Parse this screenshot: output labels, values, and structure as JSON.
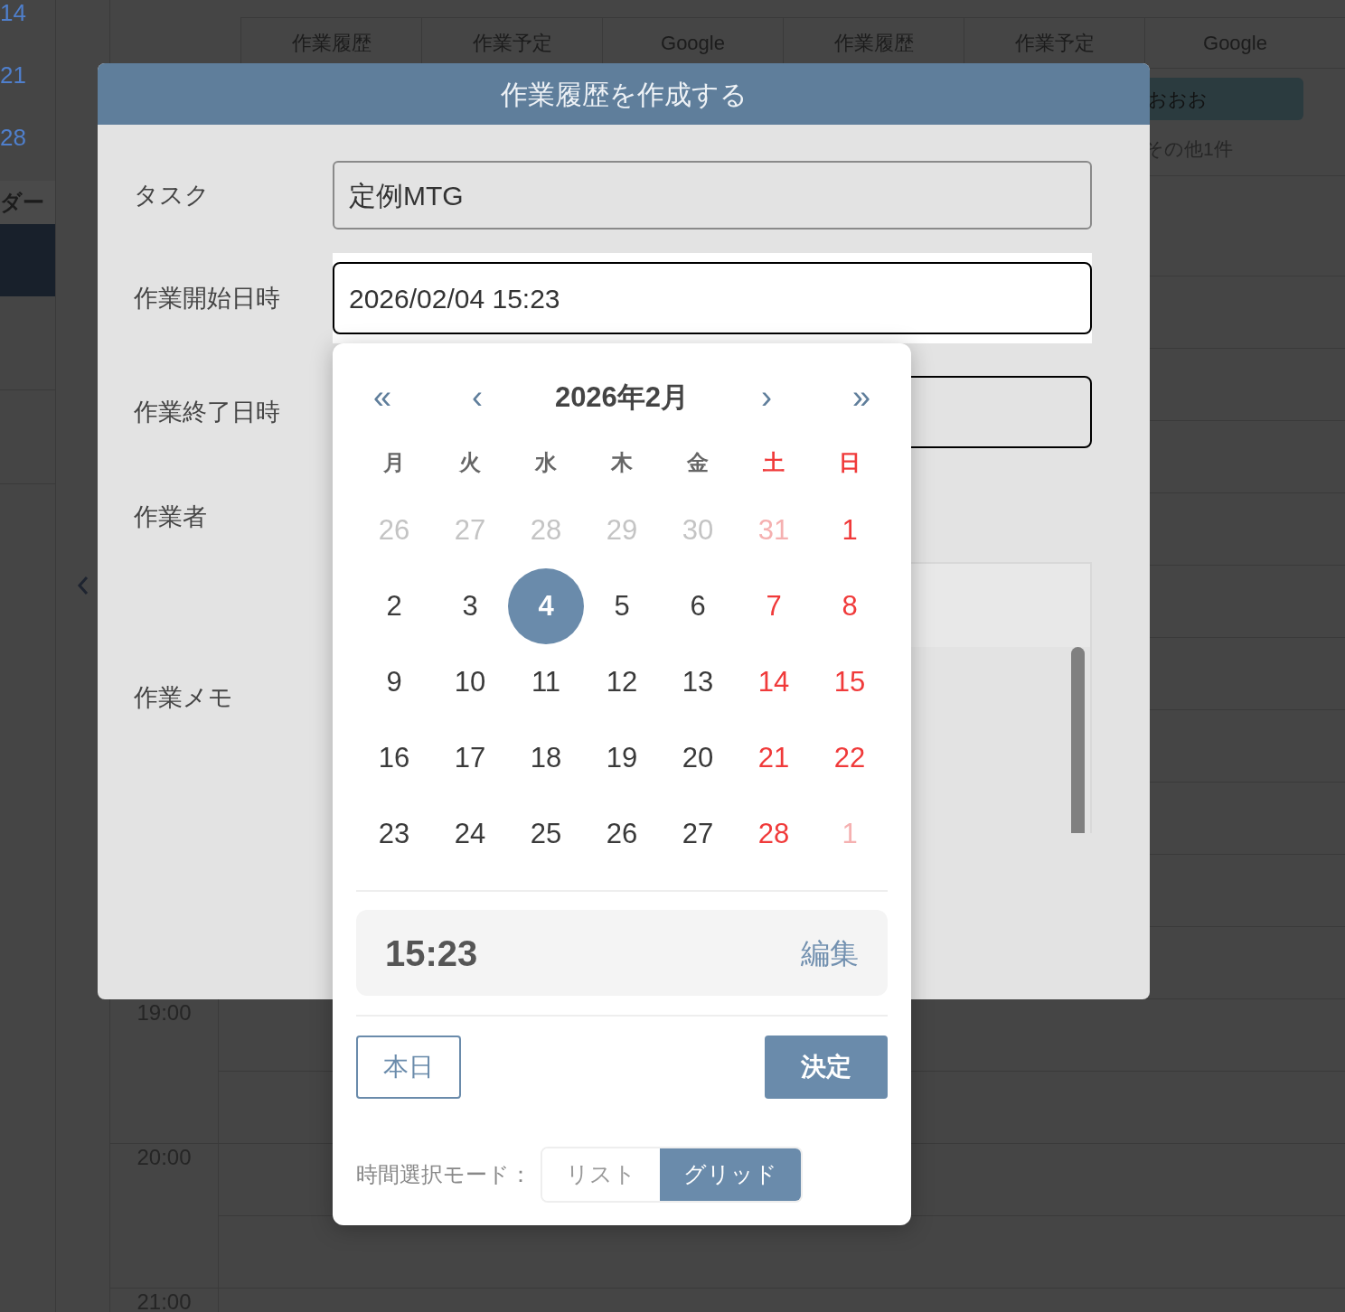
{
  "background": {
    "sidebar_dates": [
      "14",
      "21",
      "28"
    ],
    "sidebar_label": "ダー",
    "column_headers": [
      "作業履歴",
      "作業予定",
      "Google",
      "作業履歴",
      "作業予定",
      "Google"
    ],
    "event": {
      "title": "おおお",
      "more": "その他1件"
    },
    "times": [
      "19:00",
      "20:00",
      "21:00"
    ]
  },
  "dialog": {
    "title": "作業履歴を作成する",
    "fields": [
      {
        "label": "タスク",
        "kind": "text",
        "value": "定例MTG"
      },
      {
        "label": "作業開始日時",
        "kind": "datetime",
        "value": "2026/02/04 15:23",
        "focused": true
      },
      {
        "label": "作業終了日時",
        "kind": "datetime",
        "focused": false
      },
      {
        "label": "作業者",
        "kind": "hidden"
      },
      {
        "label": "作業メモ",
        "kind": "memo"
      }
    ]
  },
  "picker": {
    "nav": [
      "«",
      "‹",
      "›",
      "»"
    ],
    "month": "2026年2月",
    "weekdays": [
      {
        "label": "月",
        "weekend": false
      },
      {
        "label": "火",
        "weekend": false
      },
      {
        "label": "水",
        "weekend": false
      },
      {
        "label": "木",
        "weekend": false
      },
      {
        "label": "金",
        "weekend": false
      },
      {
        "label": "土",
        "weekend": true
      },
      {
        "label": "日",
        "weekend": true
      }
    ],
    "days": [
      {
        "label": "26",
        "outside": true,
        "weekend": false,
        "selected": false
      },
      {
        "label": "27",
        "outside": true,
        "weekend": false,
        "selected": false
      },
      {
        "label": "28",
        "outside": true,
        "weekend": false,
        "selected": false
      },
      {
        "label": "29",
        "outside": true,
        "weekend": false,
        "selected": false
      },
      {
        "label": "30",
        "outside": true,
        "weekend": false,
        "selected": false
      },
      {
        "label": "31",
        "outside": true,
        "weekend": true,
        "selected": false
      },
      {
        "label": "1",
        "outside": false,
        "weekend": true,
        "selected": false
      },
      {
        "label": "2",
        "outside": false,
        "weekend": false,
        "selected": false
      },
      {
        "label": "3",
        "outside": false,
        "weekend": false,
        "selected": false
      },
      {
        "label": "4",
        "outside": false,
        "weekend": false,
        "selected": true
      },
      {
        "label": "5",
        "outside": false,
        "weekend": false,
        "selected": false
      },
      {
        "label": "6",
        "outside": false,
        "weekend": false,
        "selected": false
      },
      {
        "label": "7",
        "outside": false,
        "weekend": true,
        "selected": false
      },
      {
        "label": "8",
        "outside": false,
        "weekend": true,
        "selected": false
      },
      {
        "label": "9",
        "outside": false,
        "weekend": false,
        "selected": false
      },
      {
        "label": "10",
        "outside": false,
        "weekend": false,
        "selected": false
      },
      {
        "label": "11",
        "outside": false,
        "weekend": false,
        "selected": false
      },
      {
        "label": "12",
        "outside": false,
        "weekend": false,
        "selected": false
      },
      {
        "label": "13",
        "outside": false,
        "weekend": false,
        "selected": false
      },
      {
        "label": "14",
        "outside": false,
        "weekend": true,
        "selected": false
      },
      {
        "label": "15",
        "outside": false,
        "weekend": true,
        "selected": false
      },
      {
        "label": "16",
        "outside": false,
        "weekend": false,
        "selected": false
      },
      {
        "label": "17",
        "outside": false,
        "weekend": false,
        "selected": false
      },
      {
        "label": "18",
        "outside": false,
        "weekend": false,
        "selected": false
      },
      {
        "label": "19",
        "outside": false,
        "weekend": false,
        "selected": false
      },
      {
        "label": "20",
        "outside": false,
        "weekend": false,
        "selected": false
      },
      {
        "label": "21",
        "outside": false,
        "weekend": true,
        "selected": false
      },
      {
        "label": "22",
        "outside": false,
        "weekend": true,
        "selected": false
      },
      {
        "label": "23",
        "outside": false,
        "weekend": false,
        "selected": false
      },
      {
        "label": "24",
        "outside": false,
        "weekend": false,
        "selected": false
      },
      {
        "label": "25",
        "outside": false,
        "weekend": false,
        "selected": false
      },
      {
        "label": "26",
        "outside": false,
        "weekend": false,
        "selected": false
      },
      {
        "label": "27",
        "outside": false,
        "weekend": false,
        "selected": false
      },
      {
        "label": "28",
        "outside": false,
        "weekend": true,
        "selected": false
      },
      {
        "label": "1",
        "outside": true,
        "weekend": true,
        "selected": false
      }
    ],
    "time": "15:23",
    "edit": "編集",
    "today": "本日",
    "confirm": "決定",
    "mode_label": "時間選択モード：",
    "modes": [
      {
        "label": "リスト",
        "selected": false
      },
      {
        "label": "グリッド",
        "selected": true
      }
    ]
  }
}
